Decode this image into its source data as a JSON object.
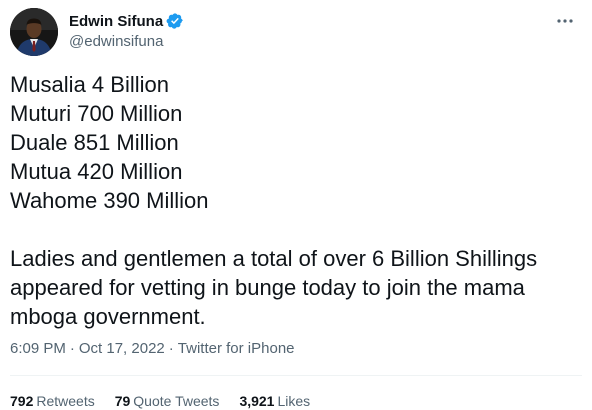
{
  "colors": {
    "text_primary": "#0f1419",
    "text_secondary": "#536471",
    "verified_blue": "#1d9bf0",
    "divider": "#eff3f4"
  },
  "header": {
    "display_name": "Edwin Sifuna",
    "handle": "@edwinsifuna",
    "verified": true,
    "avatar_icon": "profile-photo",
    "more_icon": "more-horizontal-icon"
  },
  "tweet": {
    "lines": [
      "Musalia 4 Billion",
      "Muturi 700 Million",
      "Duale 851 Million",
      "Mutua 420 Million",
      "Wahome 390 Million"
    ],
    "paragraph_lines": [
      "Ladies and gentlemen a total of over 6 Billion Shillings",
      "appeared for vetting in bunge today to join the mama",
      "mboga government."
    ]
  },
  "meta": {
    "time": "6:09 PM",
    "separator": "·",
    "date": "Oct 17, 2022",
    "source": "Twitter for iPhone"
  },
  "stats": {
    "retweets_count": "792",
    "retweets_label": "Retweets",
    "quotes_count": "79",
    "quotes_label": "Quote Tweets",
    "likes_count": "3,921",
    "likes_label": "Likes"
  }
}
